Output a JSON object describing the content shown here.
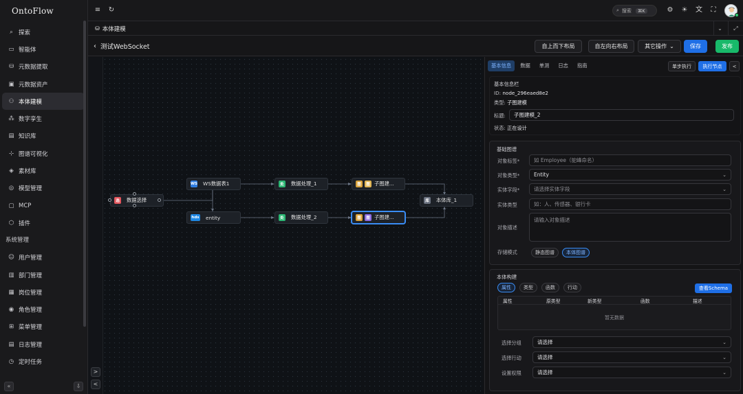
{
  "app": {
    "title": "OntoFlow"
  },
  "sidebar": {
    "items": [
      {
        "label": "探索",
        "icon": "search-icon"
      },
      {
        "label": "智能体",
        "icon": "agent-icon"
      },
      {
        "label": "元数据提取",
        "icon": "database-icon"
      },
      {
        "label": "元数据资产",
        "icon": "asset-icon"
      },
      {
        "label": "本体建模",
        "icon": "ontology-icon",
        "active": true
      },
      {
        "label": "数字孪生",
        "icon": "twin-icon"
      },
      {
        "label": "知识库",
        "icon": "book-icon"
      },
      {
        "label": "图谱可视化",
        "icon": "graph-icon"
      },
      {
        "label": "素材库",
        "icon": "cube-icon"
      },
      {
        "label": "模型管理",
        "icon": "model-icon"
      },
      {
        "label": "MCP",
        "icon": "mcp-icon"
      },
      {
        "label": "插件",
        "icon": "plugin-icon"
      }
    ],
    "section_label": "系统管理",
    "system_items": [
      {
        "label": "用户管理",
        "icon": "user-icon"
      },
      {
        "label": "部门管理",
        "icon": "department-icon"
      },
      {
        "label": "岗位管理",
        "icon": "position-icon"
      },
      {
        "label": "角色管理",
        "icon": "role-icon"
      },
      {
        "label": "菜单管理",
        "icon": "menu-icon"
      },
      {
        "label": "日志管理",
        "icon": "log-icon"
      },
      {
        "label": "定时任务",
        "icon": "timer-icon"
      }
    ]
  },
  "topbar": {
    "search_placeholder": "搜索",
    "search_shortcut": "⌘K"
  },
  "tabbar": {
    "tab_label": "本体建模"
  },
  "header": {
    "title": "测试WebSocket",
    "buttons": {
      "top_down": "自上而下布局",
      "left_right": "自左向右布局",
      "more": "其它操作",
      "save": "保存",
      "publish": "发布"
    }
  },
  "canvas": {
    "nodes": [
      {
        "id": "n1",
        "label": "数据选择",
        "badge": "选",
        "color": "#e2555c"
      },
      {
        "id": "n2",
        "label": "WS数据表1",
        "badge": "WS",
        "color": "#2f7de1"
      },
      {
        "id": "n3",
        "label": "entity",
        "badge": "hds",
        "color": "#1e88e5"
      },
      {
        "id": "n4",
        "label": "数据处理_1",
        "badge": "处",
        "color": "#2bb673"
      },
      {
        "id": "n5",
        "label": "数据处理_2",
        "badge": "处",
        "color": "#2bb673"
      },
      {
        "id": "n6",
        "label": "子图建...",
        "badge": "图",
        "color": "#d9a23a"
      },
      {
        "id": "n7",
        "label": "子图建...",
        "badge": "图",
        "color": "#8b6be0"
      },
      {
        "id": "n8",
        "label": "本体库_1",
        "badge": "库",
        "color": "#6b7280"
      }
    ]
  },
  "panel": {
    "tabs": [
      "基本信息",
      "数据",
      "单测",
      "日志",
      "指南"
    ],
    "single_step": "单步执行",
    "run_node": "执行节点",
    "basic": {
      "title": "基本信息栏",
      "id_label": "ID:",
      "id_value": "node_296eaed8e2",
      "type_label": "类型:",
      "type_value": "子图建模",
      "name_label": "标题:",
      "name_value": "子图建模_2",
      "status_label": "状态:",
      "status_value": "正在设计"
    },
    "graph": {
      "title": "基础图谱",
      "object_label": "对象标签*",
      "object_placeholder": "如 Employee（驼峰命名）",
      "object_type_label": "对象类型*",
      "object_type_value": "Entity",
      "entity_field_label": "实体字段*",
      "entity_field_placeholder": "请选择实体字段",
      "entity_type_label": "实体类型",
      "entity_type_placeholder": "如：人、传感器、银行卡",
      "desc_label": "对象描述",
      "desc_placeholder": "请输入对象描述",
      "storage_label": "存储模式",
      "storage_options": [
        "静态图谱",
        "本体图谱"
      ]
    },
    "build": {
      "title": "本体构建",
      "chips": [
        "属性",
        "类型",
        "函数",
        "行动"
      ],
      "view_schema": "查看Schema",
      "columns": [
        "属性",
        "原类型",
        "新类型",
        "函数",
        "描述"
      ],
      "empty": "暂无数据",
      "group_label": "选择分组",
      "group_value": "请选择",
      "action_label": "选择行动",
      "action_value": "请选择",
      "perm_label": "设置权限",
      "perm_value": "请选择"
    }
  }
}
